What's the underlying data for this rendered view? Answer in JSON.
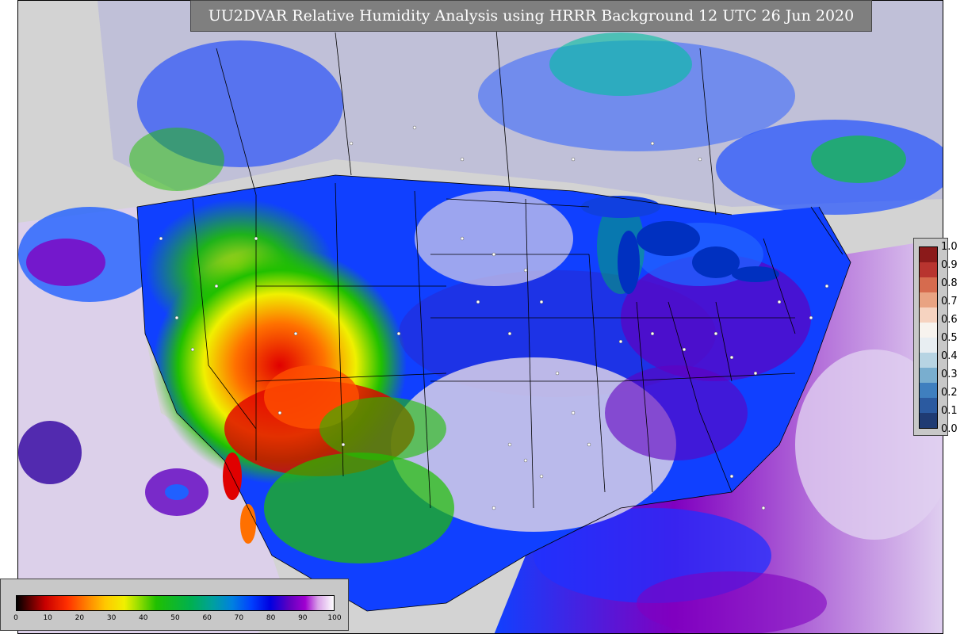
{
  "title": "UU2DVAR Relative Humidity Analysis using HRRR Background 12 UTC 26 Jun 2020",
  "obs_legend": {
    "ticks": [
      "1.0",
      "0.9",
      "0.8",
      "0.7",
      "0.6",
      "0.5",
      "0.4",
      "0.3",
      "0.2",
      "0.1",
      "0.0"
    ],
    "colors": [
      "#1f3b73",
      "#2b5aa0",
      "#3f7fbf",
      "#79aecf",
      "#b7d4e3",
      "#e8eef2",
      "#f7f3ee",
      "#f6d3c0",
      "#e9a382",
      "#d66b4e",
      "#b8342f",
      "#8b1a1a"
    ]
  },
  "rh_colorbar": {
    "ticks": [
      "0",
      "10",
      "20",
      "30",
      "40",
      "50",
      "60",
      "70",
      "80",
      "90",
      "100"
    ],
    "stops": [
      {
        "pct": 0,
        "color": "#000000"
      },
      {
        "pct": 4,
        "color": "#5a0000"
      },
      {
        "pct": 9,
        "color": "#c80000"
      },
      {
        "pct": 16,
        "color": "#ff3000"
      },
      {
        "pct": 22,
        "color": "#ff8000"
      },
      {
        "pct": 28,
        "color": "#ffc800"
      },
      {
        "pct": 34,
        "color": "#f0f000"
      },
      {
        "pct": 38,
        "color": "#a0e000"
      },
      {
        "pct": 44,
        "color": "#20c000"
      },
      {
        "pct": 55,
        "color": "#00b050"
      },
      {
        "pct": 62,
        "color": "#00a0a0"
      },
      {
        "pct": 68,
        "color": "#0080e0"
      },
      {
        "pct": 74,
        "color": "#0040ff"
      },
      {
        "pct": 80,
        "color": "#0000e0"
      },
      {
        "pct": 86,
        "color": "#6000c0"
      },
      {
        "pct": 91,
        "color": "#a000d0"
      },
      {
        "pct": 95,
        "color": "#d8a0e8"
      },
      {
        "pct": 100,
        "color": "#ffffff"
      }
    ]
  },
  "map_colors": {
    "land_background": "#d3d3d3",
    "dry_core": "#e00000",
    "dry_mid": "#ff9000",
    "dry_yellow": "#f0f000",
    "moist_green": "#20c000",
    "moist_blue": "#0040ff",
    "very_moist_purple": "#8000c0",
    "saturated_light": "#e8d8f0",
    "ocean_blue": "#2060ff",
    "borders": "#000000"
  }
}
